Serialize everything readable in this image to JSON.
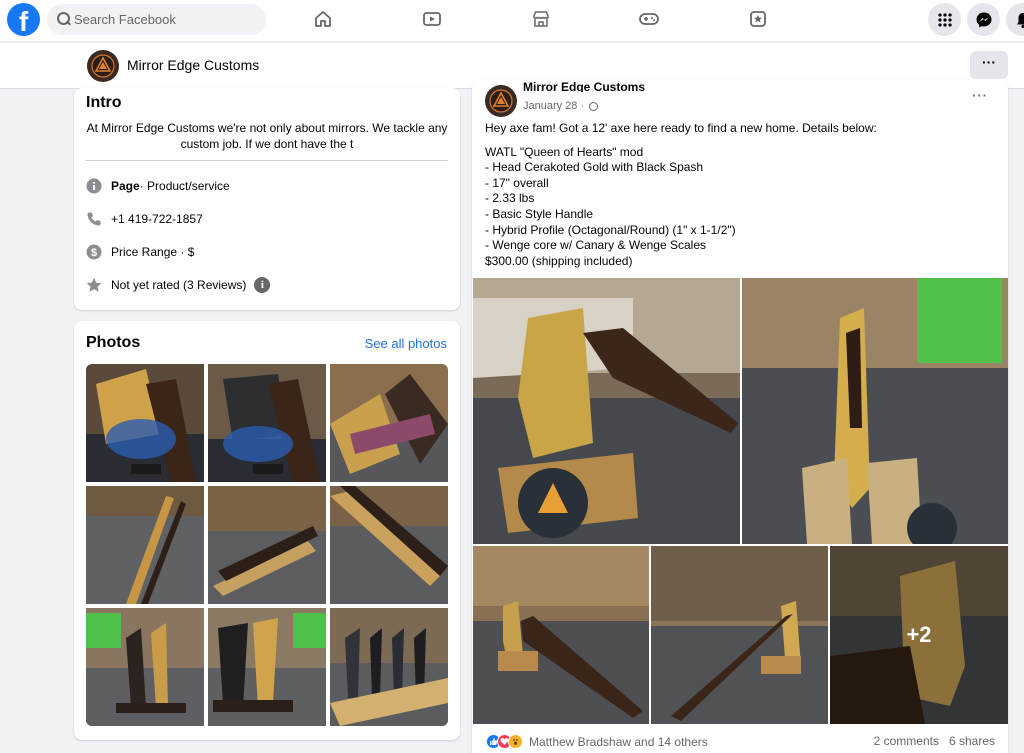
{
  "nav": {
    "logo": "f",
    "search_placeholder": "Search Facebook",
    "icons": [
      "home-icon",
      "watch-icon",
      "marketplace-icon",
      "gaming-icon",
      "pages-icon"
    ],
    "right_icons": [
      "menu-grid-icon",
      "messenger-icon",
      "notifications-icon"
    ]
  },
  "header": {
    "page_name": "Mirror Edge Customs",
    "more": "···"
  },
  "intro": {
    "title": "Intro",
    "bio": "At Mirror Edge Customs we're not only about mirrors. We tackle any custom job. If we dont have the t",
    "page_label": "Page",
    "page_category": " · Product/service",
    "phone": "+1 419-722-1857",
    "price_range": "Price Range · $",
    "rating": "Not yet rated (3 Reviews)",
    "info_glyph": "i"
  },
  "photos": {
    "title": "Photos",
    "see_all": "See all photos"
  },
  "post": {
    "author": "Mirror Edge Customs",
    "date": "January 28 · ",
    "menu": "···",
    "lines": [
      "Hey axe fam! Got a 12' axe here ready to find a new home. Details below:",
      "WATL \"Queen of Hearts\" mod",
      "- Head Cerakoted Gold with Black Spash",
      "- 17\" overall",
      "- 2.33 lbs",
      "- Basic Style Handle",
      "- Hybrid Profile (Octagonal/Round) (1\" x 1-1/2\")",
      "- Wenge core w/ Canary & Wenge Scales",
      "$300.00 (shipping included)"
    ],
    "more_photos": "+2",
    "reactions_text": "Matthew Bradshaw and 14 others",
    "comments": "2 comments",
    "shares": "6 shares"
  },
  "colors": {
    "brand": "#1877f2",
    "link": "#216fdb",
    "bg": "#f0f2f5",
    "secondary_text": "#65676b"
  }
}
